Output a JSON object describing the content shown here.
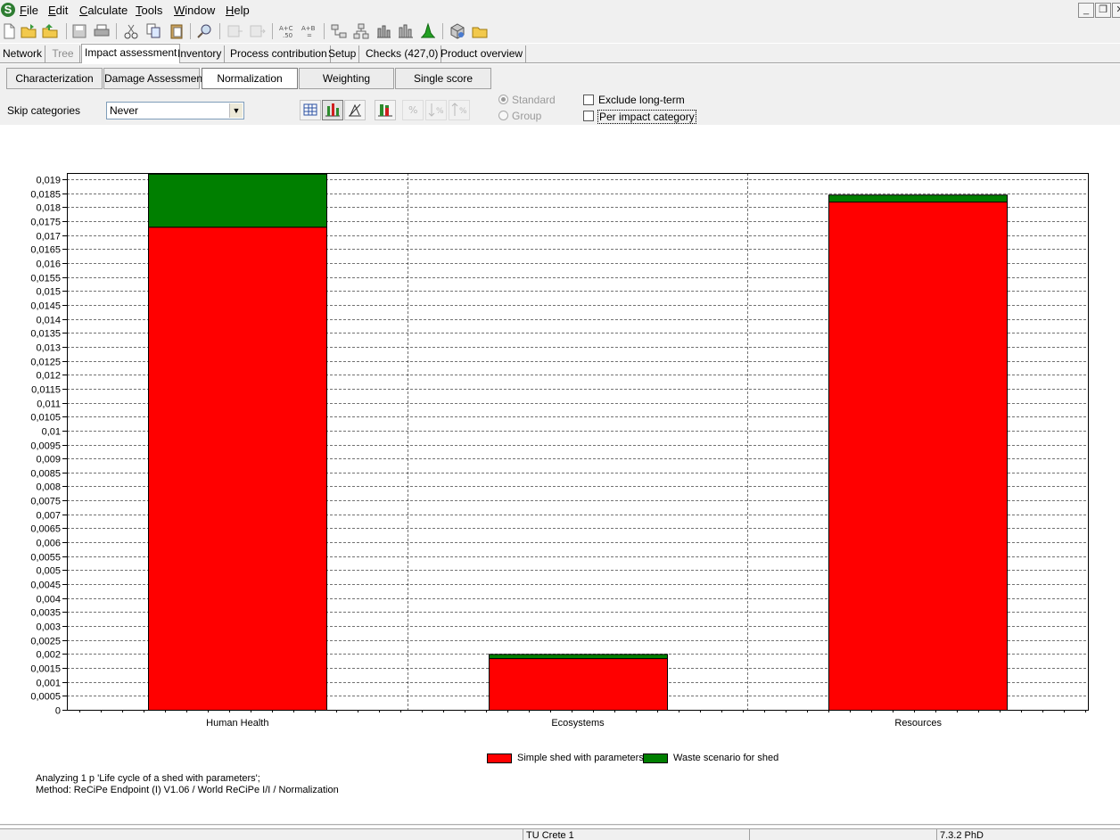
{
  "menu": {
    "items": [
      {
        "label": "File"
      },
      {
        "label": "Edit"
      },
      {
        "label": "Calculate"
      },
      {
        "label": "Tools"
      },
      {
        "label": "Window"
      },
      {
        "label": "Help"
      }
    ]
  },
  "toolbar": {
    "icons": [
      "new-file-icon",
      "open-folder-icon",
      "open-project-icon",
      "save-icon",
      "print-icon",
      "cut-icon",
      "copy-icon",
      "paste-icon",
      "find-icon",
      "copy-stage-icon",
      "paste-stage-icon",
      "formula-ac-icon",
      "formula-ab-icon",
      "network-icon",
      "tree-icon",
      "bar-chart-icon",
      "stacked-bar-icon",
      "monte-carlo-icon",
      "cube-3d-icon",
      "open-library-icon"
    ],
    "formula_ac_label": "A+C .50",
    "formula_ab_label": "A+B ="
  },
  "main_tabs": [
    {
      "label": "Network",
      "state": "normal"
    },
    {
      "label": "Tree",
      "state": "disabled"
    },
    {
      "label": "Impact assessment",
      "state": "active"
    },
    {
      "label": "Inventory",
      "state": "normal"
    },
    {
      "label": "Process contribution",
      "state": "normal"
    },
    {
      "label": "Setup",
      "state": "normal"
    },
    {
      "label": "Checks (427,0)",
      "state": "normal"
    },
    {
      "label": "Product overview",
      "state": "normal"
    }
  ],
  "sub_tabs": [
    {
      "label": "Characterization",
      "active": false
    },
    {
      "label": "Damage Assessment",
      "active": false
    },
    {
      "label": "Normalization",
      "active": true
    },
    {
      "label": "Weighting",
      "active": false
    },
    {
      "label": "Single score",
      "active": false
    }
  ],
  "options": {
    "skip_label": "Skip categories",
    "skip_value": "Never",
    "radio_standard": "Standard",
    "radio_group": "Group",
    "exclude_long_term": "Exclude long-term",
    "per_impact_category": "Per impact category"
  },
  "chart_data": {
    "type": "bar",
    "stacked": true,
    "categories": [
      "Human Health",
      "Ecosystems",
      "Resources"
    ],
    "series": [
      {
        "name": "Simple shed with parameters",
        "color": "#ff0000",
        "values": [
          0.0173,
          0.00185,
          0.0182
        ]
      },
      {
        "name": "Waste scenario for shed",
        "color": "#007f00",
        "values": [
          0.0019,
          0.00015,
          0.00025
        ]
      }
    ],
    "ylim": [
      0,
      0.019
    ],
    "ytick_labels": [
      "0",
      "0,0005",
      "0,001",
      "0,0015",
      "0,002",
      "0,0025",
      "0,003",
      "0,0035",
      "0,004",
      "0,0045",
      "0,005",
      "0,0055",
      "0,006",
      "0,0065",
      "0,007",
      "0,0075",
      "0,008",
      "0,0085",
      "0,009",
      "0,0095",
      "0,01",
      "0,0105",
      "0,011",
      "0,0115",
      "0,012",
      "0,0125",
      "0,013",
      "0,0135",
      "0,014",
      "0,0145",
      "0,015",
      "0,0155",
      "0,016",
      "0,0165",
      "0,017",
      "0,0175",
      "0,018",
      "0,0185",
      "0,019"
    ],
    "grid": true,
    "legend_position": "bottom-center"
  },
  "info": {
    "line1": "Analyzing 1 p 'Life cycle of a shed with parameters';",
    "line2": "Method: ReCiPe Endpoint (I) V1.06 / World ReCiPe I/I / Normalization"
  },
  "status": {
    "cell1": "",
    "cell2": "TU Crete 1",
    "cell3": "",
    "cell4": "7.3.2 PhD"
  }
}
